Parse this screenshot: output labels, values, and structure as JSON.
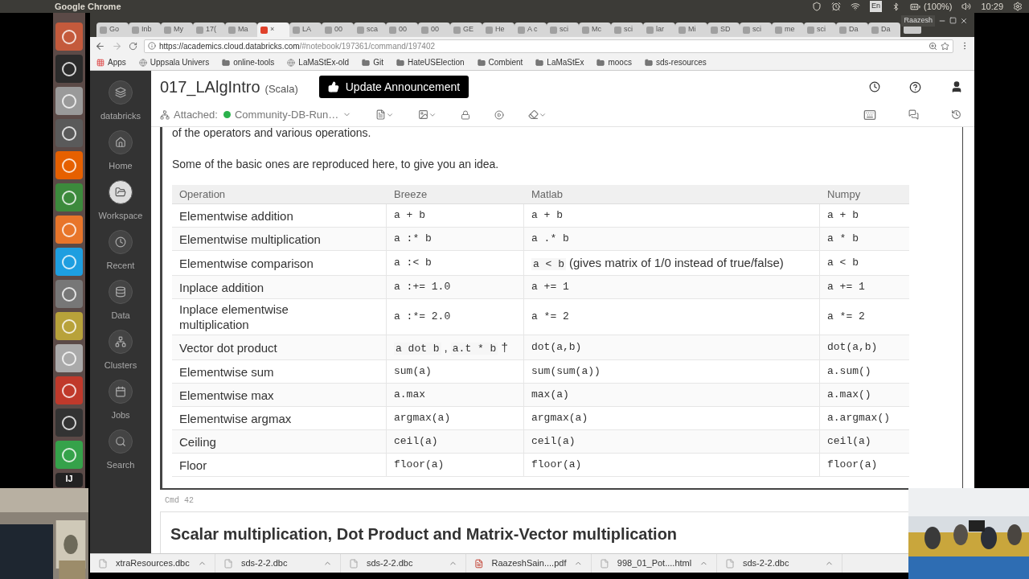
{
  "system_bar": {
    "title": "Google Chrome",
    "keyboard": "En",
    "battery": "(100%)",
    "time": "10:29"
  },
  "launcher": {
    "ide_label": "IJ"
  },
  "browser": {
    "user": "Raazesh",
    "tabs": [
      {
        "label": "Go",
        "selected": false
      },
      {
        "label": "Inb",
        "selected": false
      },
      {
        "label": "My",
        "selected": false
      },
      {
        "label": "17(",
        "selected": false
      },
      {
        "label": "Ma",
        "selected": false
      },
      {
        "label": "×",
        "selected": true
      },
      {
        "label": "LA",
        "selected": false
      },
      {
        "label": "00",
        "selected": false
      },
      {
        "label": "sca",
        "selected": false
      },
      {
        "label": "00",
        "selected": false
      },
      {
        "label": "00",
        "selected": false
      },
      {
        "label": "GE",
        "selected": false
      },
      {
        "label": "He",
        "selected": false
      },
      {
        "label": "A c",
        "selected": false
      },
      {
        "label": "sci",
        "selected": false
      },
      {
        "label": "Mc",
        "selected": false
      },
      {
        "label": "sci",
        "selected": false
      },
      {
        "label": "lar",
        "selected": false
      },
      {
        "label": "Mi",
        "selected": false
      },
      {
        "label": "SD",
        "selected": false
      },
      {
        "label": "sci",
        "selected": false
      },
      {
        "label": "me",
        "selected": false
      },
      {
        "label": "sci",
        "selected": false
      },
      {
        "label": "Da",
        "selected": false
      },
      {
        "label": "Da",
        "selected": false
      }
    ],
    "url_host": "https://academics.cloud.databricks.com",
    "url_path": "/#notebook/197361/command/197402",
    "bookmarks": [
      {
        "label": "Apps",
        "kind": "apps"
      },
      {
        "label": "Uppsala Univers",
        "kind": "site"
      },
      {
        "label": "online-tools",
        "kind": "folder"
      },
      {
        "label": "LaMaStEx-old",
        "kind": "site"
      },
      {
        "label": "Git",
        "kind": "folder"
      },
      {
        "label": "HateUSElection",
        "kind": "folder"
      },
      {
        "label": "Combient",
        "kind": "folder"
      },
      {
        "label": "LaMaStEx",
        "kind": "folder"
      },
      {
        "label": "moocs",
        "kind": "folder"
      },
      {
        "label": "sds-resources",
        "kind": "folder"
      }
    ]
  },
  "sidebar": {
    "items": [
      {
        "label": "databricks",
        "selected": false
      },
      {
        "label": "Home",
        "selected": false
      },
      {
        "label": "Workspace",
        "selected": true
      },
      {
        "label": "Recent",
        "selected": false
      },
      {
        "label": "Data",
        "selected": false
      },
      {
        "label": "Clusters",
        "selected": false
      },
      {
        "label": "Jobs",
        "selected": false
      },
      {
        "label": "Search",
        "selected": false
      }
    ]
  },
  "notebook": {
    "title": "017_LAlgIntro",
    "language": "(Scala)",
    "announcement": "Update Announcement",
    "attached_label": "Attached:",
    "cluster": "Community-DB-Run…",
    "cluster_running": true
  },
  "cell": {
    "partial_text": "of the operators and various operations.",
    "intro": "Some of the basic ones are reproduced here, to give you an idea.",
    "table": {
      "columns": [
        "Operation",
        "Breeze",
        "Matlab",
        "Numpy"
      ],
      "rows": [
        [
          "Elementwise addition",
          "a + b",
          "a + b",
          "a + b"
        ],
        [
          "Elementwise multiplication",
          "a :* b",
          "a .* b",
          "a * b"
        ],
        [
          "Elementwise comparison",
          "a :< b",
          [
            {
              "kind": "code",
              "text": "a < b"
            },
            {
              "kind": "text",
              "text": "(gives matrix of 1/0 instead of true/false)"
            }
          ],
          "a < b"
        ],
        [
          "Inplace addition",
          "a :+= 1.0",
          "a += 1",
          "a += 1"
        ],
        [
          "Inplace elementwise multiplication",
          "a :*= 2.0",
          "a *= 2",
          "a *= 2"
        ],
        [
          "Vector dot product",
          [
            {
              "kind": "code",
              "text": "a dot b"
            },
            {
              "kind": "text",
              "text": ","
            },
            {
              "kind": "code",
              "text": "a.t * b"
            },
            {
              "kind": "text",
              "text": "†"
            }
          ],
          "dot(a,b)",
          "dot(a,b)"
        ],
        [
          "Elementwise sum",
          "sum(a)",
          "sum(sum(a))",
          "a.sum()"
        ],
        [
          "Elementwise max",
          "a.max",
          "max(a)",
          "a.max()"
        ],
        [
          "Elementwise argmax",
          "argmax(a)",
          "argmax(a)",
          "a.argmax()"
        ],
        [
          "Ceiling",
          "ceil(a)",
          "ceil(a)",
          "ceil(a)"
        ],
        [
          "Floor",
          "floor(a)",
          "floor(a)",
          "floor(a)"
        ]
      ]
    }
  },
  "next_cell": {
    "label": "Cmd 42",
    "heading": "Scalar multiplication, Dot Product and Matrix-Vector multiplication"
  },
  "downloads": [
    {
      "name": "xtraResources.dbc",
      "kind": "file"
    },
    {
      "name": "sds-2-2.dbc",
      "kind": "file"
    },
    {
      "name": "sds-2-2.dbc",
      "kind": "file"
    },
    {
      "name": "RaazeshSain....pdf",
      "kind": "pdf"
    },
    {
      "name": "998_01_Pot....html",
      "kind": "file"
    },
    {
      "name": "sds-2-2.dbc",
      "kind": "file"
    }
  ]
}
